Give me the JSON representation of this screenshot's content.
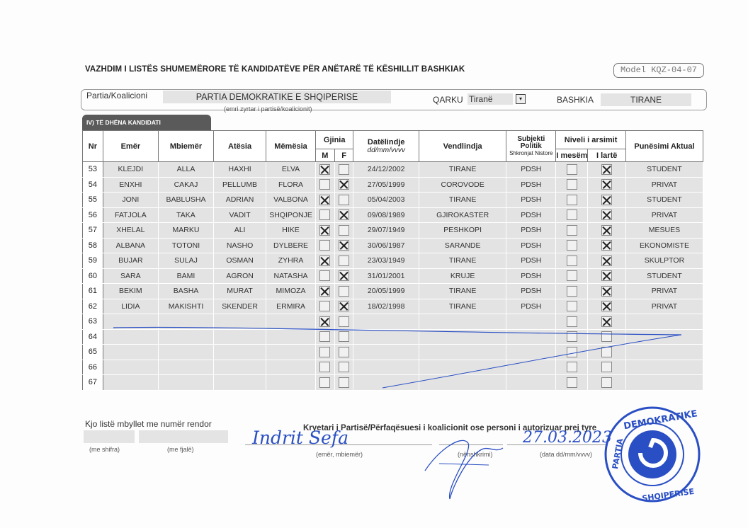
{
  "title": "VAZHDIM I LISTËS SHUMEMËRORE TË KANDIDATËVE PËR ANËTARË TË KËSHILLIT BASHKIAK",
  "model": "Model KQZ-04-07",
  "party": {
    "label": "Partia/Koalicioni",
    "value": "PARTIA DEMOKRATIKE E SHQIPERISE",
    "hint": "(emri zyrtar i partisë/koalicionit)",
    "qarku_label": "QARKU",
    "qarku_value": "Tiranë",
    "bashkia_label": "BASHKIA",
    "bashkia_value": "TIRANE"
  },
  "section_title": "IV) TË DHËNA KANDIDATI",
  "headers": {
    "nr": "Nr",
    "emer": "Emër",
    "mbiemer": "Mbiemër",
    "atesia": "Atësia",
    "memesia": "Mëmësia",
    "gjinia": "Gjinia",
    "m": "M",
    "f": "F",
    "datelindje": "Datëlindje",
    "date_format": "dd/mm/vvvv",
    "vendlindja": "Vendlindja",
    "subjekti": "Subjekti Politik",
    "shkronjat": "Shkronjat Nistore",
    "niveli": "Niveli i arsimit",
    "mesem": "I mesëm",
    "larte": "I lartë",
    "punesimi": "Punësimi Aktual"
  },
  "rows": [
    {
      "nr": "53",
      "emer": "KLEJDI",
      "mbiemer": "ALLA",
      "atesia": "HAXHI",
      "memesia": "ELVA",
      "gender": "M",
      "dob": "24/12/2002",
      "vendlindja": "TIRANE",
      "subjekti": "PDSH",
      "larte": true,
      "punesimi": "STUDENT"
    },
    {
      "nr": "54",
      "emer": "ENXHI",
      "mbiemer": "CAKAJ",
      "atesia": "PELLUMB",
      "memesia": "FLORA",
      "gender": "F",
      "dob": "27/05/1999",
      "vendlindja": "COROVODE",
      "subjekti": "PDSH",
      "larte": true,
      "punesimi": "PRIVAT"
    },
    {
      "nr": "55",
      "emer": "JONI",
      "mbiemer": "BABLUSHA",
      "atesia": "ADRIAN",
      "memesia": "VALBONA",
      "gender": "M",
      "dob": "05/04/2003",
      "vendlindja": "TIRANE",
      "subjekti": "PDSH",
      "larte": true,
      "punesimi": "STUDENT"
    },
    {
      "nr": "56",
      "emer": "FATJOLA",
      "mbiemer": "TAKA",
      "atesia": "VADIT",
      "memesia": "SHQIPONJE",
      "gender": "F",
      "dob": "09/08/1989",
      "vendlindja": "GJIROKASTER",
      "subjekti": "PDSH",
      "larte": true,
      "punesimi": "PRIVAT"
    },
    {
      "nr": "57",
      "emer": "XHELAL",
      "mbiemer": "MARKU",
      "atesia": "ALI",
      "memesia": "HIKE",
      "gender": "M",
      "dob": "29/07/1949",
      "vendlindja": "PESHKOPI",
      "subjekti": "PDSH",
      "larte": true,
      "punesimi": "MESUES"
    },
    {
      "nr": "58",
      "emer": "ALBANA",
      "mbiemer": "TOTONI",
      "atesia": "NASHO",
      "memesia": "DYLBERE",
      "gender": "F",
      "dob": "30/06/1987",
      "vendlindja": "SARANDE",
      "subjekti": "PDSH",
      "larte": true,
      "punesimi": "EKONOMISTE"
    },
    {
      "nr": "59",
      "emer": "BUJAR",
      "mbiemer": "SULAJ",
      "atesia": "OSMAN",
      "memesia": "ZYHRA",
      "gender": "M",
      "dob": "23/03/1949",
      "vendlindja": "TIRANE",
      "subjekti": "PDSH",
      "larte": true,
      "punesimi": "SKULPTOR"
    },
    {
      "nr": "60",
      "emer": "SARA",
      "mbiemer": "BAMI",
      "atesia": "AGRON",
      "memesia": "NATASHA",
      "gender": "F",
      "dob": "31/01/2001",
      "vendlindja": "KRUJE",
      "subjekti": "PDSH",
      "larte": true,
      "punesimi": "STUDENT"
    },
    {
      "nr": "61",
      "emer": "BEKIM",
      "mbiemer": "BASHA",
      "atesia": "MURAT",
      "memesia": "MIMOZA",
      "gender": "M",
      "dob": "20/05/1999",
      "vendlindja": "TIRANE",
      "subjekti": "PDSH",
      "larte": true,
      "punesimi": "PRIVAT"
    },
    {
      "nr": "62",
      "emer": "LIDIA",
      "mbiemer": "MAKISHTI",
      "atesia": "SKENDER",
      "memesia": "ERMIRA",
      "gender": "F",
      "dob": "18/02/1998",
      "vendlindja": "TIRANE",
      "subjekti": "PDSH",
      "larte": true,
      "punesimi": "PRIVAT"
    },
    {
      "nr": "63",
      "emer": "",
      "mbiemer": "",
      "atesia": "",
      "memesia": "",
      "gender": "M",
      "dob": "",
      "vendlindja": "",
      "subjekti": "",
      "larte": true,
      "punesimi": ""
    },
    {
      "nr": "64",
      "emer": "",
      "mbiemer": "",
      "atesia": "",
      "memesia": "",
      "gender": "",
      "dob": "",
      "vendlindja": "",
      "subjekti": "",
      "larte": false,
      "punesimi": ""
    },
    {
      "nr": "65",
      "emer": "",
      "mbiemer": "",
      "atesia": "",
      "memesia": "",
      "gender": "",
      "dob": "",
      "vendlindja": "",
      "subjekti": "",
      "larte": false,
      "punesimi": ""
    },
    {
      "nr": "66",
      "emer": "",
      "mbiemer": "",
      "atesia": "",
      "memesia": "",
      "gender": "",
      "dob": "",
      "vendlindja": "",
      "subjekti": "",
      "larte": false,
      "punesimi": ""
    },
    {
      "nr": "67",
      "emer": "",
      "mbiemer": "",
      "atesia": "",
      "memesia": "",
      "gender": "",
      "dob": "",
      "vendlindja": "",
      "subjekti": "",
      "larte": false,
      "punesimi": ""
    }
  ],
  "footer": {
    "closing": "Kjo listë mbyllet me numër rendor",
    "shifra": "(me shifra)",
    "fjale": "(me fjalë)",
    "kryetari": "Kryetari i Partisë/Përfaqësuesi i koalicionit ose personi i autorizuar prej tyre",
    "emer_mbiemer": "(emër, mbiemër)",
    "nenshkrimi": "(nënshkrimi)",
    "data_hint": "(data dd/mm/vvvv)",
    "handwritten_name": "Indrit Sefa",
    "handwritten_date": "27.03.2023"
  },
  "stamp": {
    "text_top": "DEMOKRATIKE",
    "text_left": "PARTIA",
    "text_right": "E SHQIPERISE",
    "color": "#2a4fc4"
  }
}
